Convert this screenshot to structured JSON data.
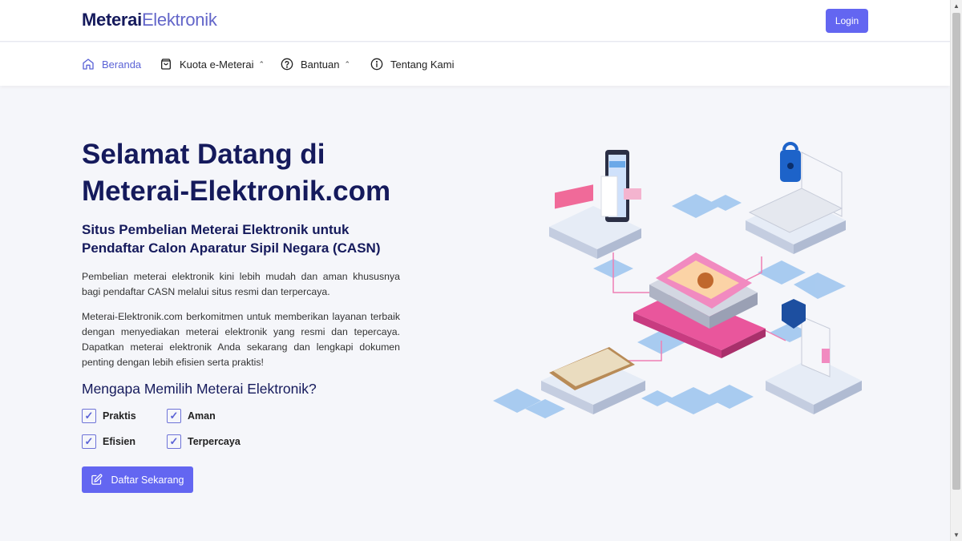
{
  "header": {
    "brand_bold": "Meterai",
    "brand_light": "Elektronik",
    "login_label": "Login"
  },
  "nav": {
    "items": [
      {
        "label": "Beranda",
        "icon": "home-icon",
        "dropdown": false
      },
      {
        "label": "Kuota e-Meterai",
        "icon": "shopping-bag-icon",
        "dropdown": true
      },
      {
        "label": "Bantuan",
        "icon": "help-circle-icon",
        "dropdown": true
      },
      {
        "label": "Tentang Kami",
        "icon": "info-icon",
        "dropdown": false
      }
    ]
  },
  "hero": {
    "title_line1": "Selamat Datang di",
    "title_line2": "Meterai-Elektronik.com",
    "subtitle": "Situs Pembelian Meterai Elektronik untuk Pendaftar Calon Aparatur Sipil Negara (CASN)",
    "paragraph1": "Pembelian meterai elektronik kini lebih mudah dan aman khususnya bagi pendaftar CASN melalui situs resmi dan terpercaya.",
    "paragraph2": "Meterai-Elektronik.com berkomitmen untuk memberikan layanan terbaik dengan menyediakan meterai elektronik yang resmi dan tepercaya. Dapatkan meterai elektronik Anda sekarang dan lengkapi dokumen penting dengan lebih efisien serta praktis!",
    "why_title": "Mengapa Memilih Meterai Elektronik?",
    "features": [
      "Praktis",
      "Aman",
      "Efisien",
      "Terpercaya"
    ],
    "cta_label": "Daftar Sekarang"
  },
  "colors": {
    "primary": "#6366f1",
    "navy": "#151a5c",
    "active_nav": "#5b63d6",
    "background": "#f5f6fa",
    "accent_pink": "#e9569c",
    "accent_blue": "#6aa8e8"
  }
}
